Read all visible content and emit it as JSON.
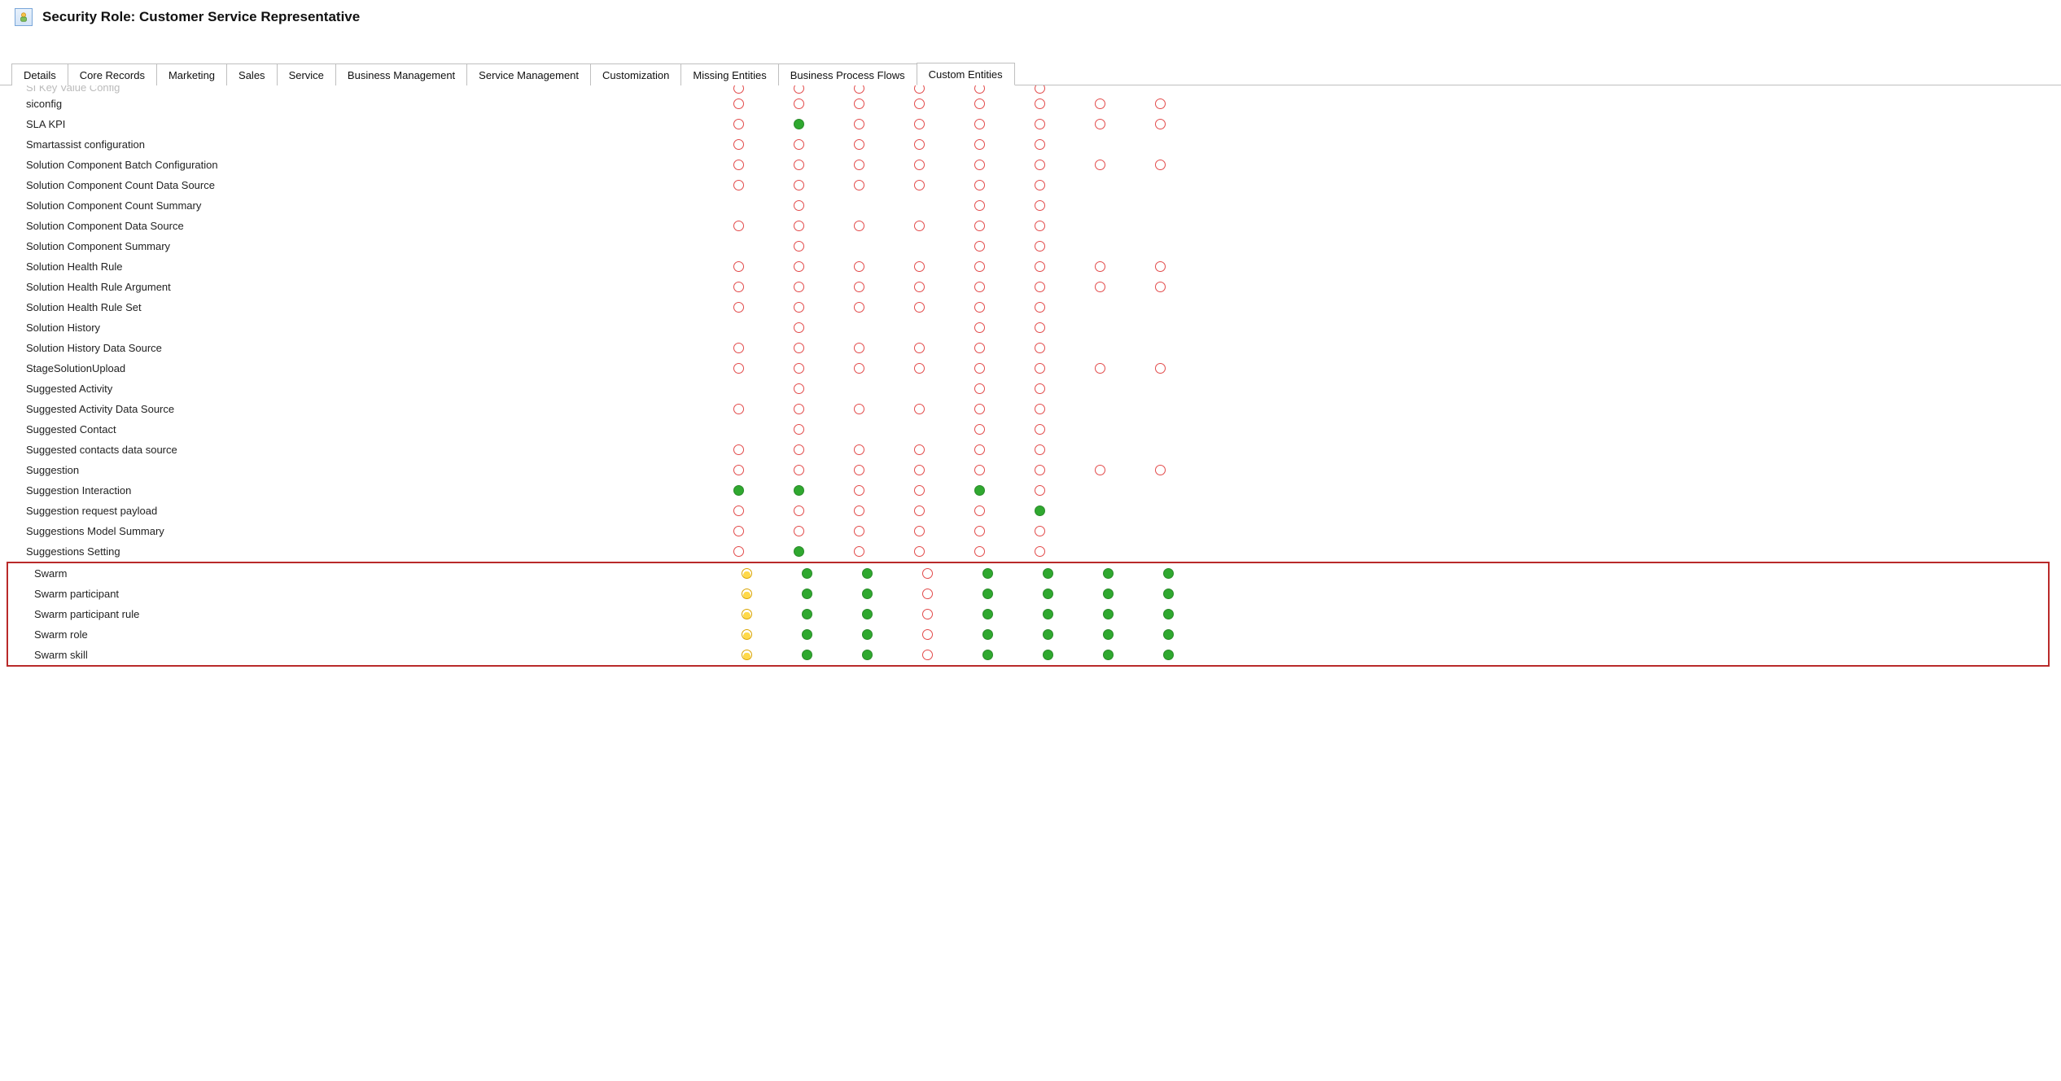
{
  "header": {
    "title": "Security Role: Customer Service Representative"
  },
  "tabs": [
    {
      "label": "Details",
      "active": false
    },
    {
      "label": "Core Records",
      "active": false
    },
    {
      "label": "Marketing",
      "active": false
    },
    {
      "label": "Sales",
      "active": false
    },
    {
      "label": "Service",
      "active": false
    },
    {
      "label": "Business Management",
      "active": false
    },
    {
      "label": "Service Management",
      "active": false
    },
    {
      "label": "Customization",
      "active": false
    },
    {
      "label": "Missing Entities",
      "active": false
    },
    {
      "label": "Business Process Flows",
      "active": false
    },
    {
      "label": "Custom Entities",
      "active": true
    }
  ],
  "legend": {
    "e": "none",
    "g": "organization",
    "a": "user-amber",
    "": "blank"
  },
  "rows": [
    {
      "label": "SI Key Value Config",
      "cells": [
        "e",
        "e",
        "e",
        "e",
        "e",
        "e",
        "",
        ""
      ],
      "cutoff": true
    },
    {
      "label": "siconfig",
      "cells": [
        "e",
        "e",
        "e",
        "e",
        "e",
        "e",
        "e",
        "e"
      ]
    },
    {
      "label": "SLA KPI",
      "cells": [
        "e",
        "g",
        "e",
        "e",
        "e",
        "e",
        "e",
        "e"
      ]
    },
    {
      "label": "Smartassist configuration",
      "cells": [
        "e",
        "e",
        "e",
        "e",
        "e",
        "e",
        "",
        ""
      ]
    },
    {
      "label": "Solution Component Batch Configuration",
      "cells": [
        "e",
        "e",
        "e",
        "e",
        "e",
        "e",
        "e",
        "e"
      ]
    },
    {
      "label": "Solution Component Count Data Source",
      "cells": [
        "e",
        "e",
        "e",
        "e",
        "e",
        "e",
        "",
        ""
      ]
    },
    {
      "label": "Solution Component Count Summary",
      "cells": [
        "",
        "e",
        "",
        "",
        "e",
        "e",
        "",
        ""
      ]
    },
    {
      "label": "Solution Component Data Source",
      "cells": [
        "e",
        "e",
        "e",
        "e",
        "e",
        "e",
        "",
        ""
      ]
    },
    {
      "label": "Solution Component Summary",
      "cells": [
        "",
        "e",
        "",
        "",
        "e",
        "e",
        "",
        ""
      ]
    },
    {
      "label": "Solution Health Rule",
      "cells": [
        "e",
        "e",
        "e",
        "e",
        "e",
        "e",
        "e",
        "e"
      ]
    },
    {
      "label": "Solution Health Rule Argument",
      "cells": [
        "e",
        "e",
        "e",
        "e",
        "e",
        "e",
        "e",
        "e"
      ]
    },
    {
      "label": "Solution Health Rule Set",
      "cells": [
        "e",
        "e",
        "e",
        "e",
        "e",
        "e",
        "",
        ""
      ]
    },
    {
      "label": "Solution History",
      "cells": [
        "",
        "e",
        "",
        "",
        "e",
        "e",
        "",
        ""
      ]
    },
    {
      "label": "Solution History Data Source",
      "cells": [
        "e",
        "e",
        "e",
        "e",
        "e",
        "e",
        "",
        ""
      ]
    },
    {
      "label": "StageSolutionUpload",
      "cells": [
        "e",
        "e",
        "e",
        "e",
        "e",
        "e",
        "e",
        "e"
      ]
    },
    {
      "label": "Suggested Activity",
      "cells": [
        "",
        "e",
        "",
        "",
        "e",
        "e",
        "",
        ""
      ]
    },
    {
      "label": "Suggested Activity Data Source",
      "cells": [
        "e",
        "e",
        "e",
        "e",
        "e",
        "e",
        "",
        ""
      ]
    },
    {
      "label": "Suggested Contact",
      "cells": [
        "",
        "e",
        "",
        "",
        "e",
        "e",
        "",
        ""
      ]
    },
    {
      "label": "Suggested contacts data source",
      "cells": [
        "e",
        "e",
        "e",
        "e",
        "e",
        "e",
        "",
        ""
      ]
    },
    {
      "label": "Suggestion",
      "cells": [
        "e",
        "e",
        "e",
        "e",
        "e",
        "e",
        "e",
        "e"
      ]
    },
    {
      "label": "Suggestion Interaction",
      "cells": [
        "g",
        "g",
        "e",
        "e",
        "g",
        "e",
        "",
        ""
      ]
    },
    {
      "label": "Suggestion request payload",
      "cells": [
        "e",
        "e",
        "e",
        "e",
        "e",
        "g",
        "",
        ""
      ]
    },
    {
      "label": "Suggestions Model Summary",
      "cells": [
        "e",
        "e",
        "e",
        "e",
        "e",
        "e",
        "",
        ""
      ]
    },
    {
      "label": "Suggestions Setting",
      "cells": [
        "e",
        "g",
        "e",
        "e",
        "e",
        "e",
        "",
        ""
      ]
    }
  ],
  "highlightedRows": [
    {
      "label": "Swarm",
      "cells": [
        "a",
        "g",
        "g",
        "e",
        "g",
        "g",
        "g",
        "g"
      ]
    },
    {
      "label": "Swarm participant",
      "cells": [
        "a",
        "g",
        "g",
        "e",
        "g",
        "g",
        "g",
        "g"
      ]
    },
    {
      "label": "Swarm participant rule",
      "cells": [
        "a",
        "g",
        "g",
        "e",
        "g",
        "g",
        "g",
        "g"
      ]
    },
    {
      "label": "Swarm role",
      "cells": [
        "a",
        "g",
        "g",
        "e",
        "g",
        "g",
        "g",
        "g"
      ]
    },
    {
      "label": "Swarm skill",
      "cells": [
        "a",
        "g",
        "g",
        "e",
        "g",
        "g",
        "g",
        "g"
      ]
    }
  ]
}
